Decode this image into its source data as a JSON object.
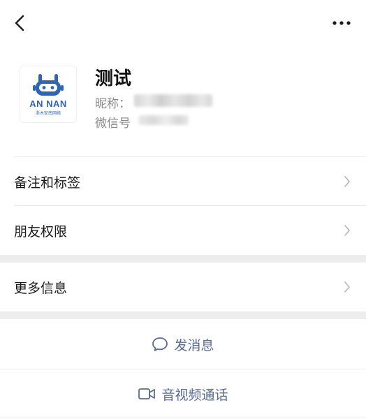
{
  "profile": {
    "name": "测试",
    "nickname_label": "昵称：",
    "wechat_id_label": "微信号",
    "avatar": {
      "logo_text": "AN NAN",
      "logo_sub": "浙木安南网络"
    }
  },
  "menu": [
    {
      "label": "备注和标签"
    },
    {
      "label": "朋友权限"
    },
    {
      "label": "更多信息"
    }
  ],
  "actions": {
    "send_message": "发消息",
    "video_call": "音视频通话"
  },
  "colors": {
    "link": "#576b95",
    "separator": "#ededed",
    "logo_blue": "#2f66b3"
  }
}
